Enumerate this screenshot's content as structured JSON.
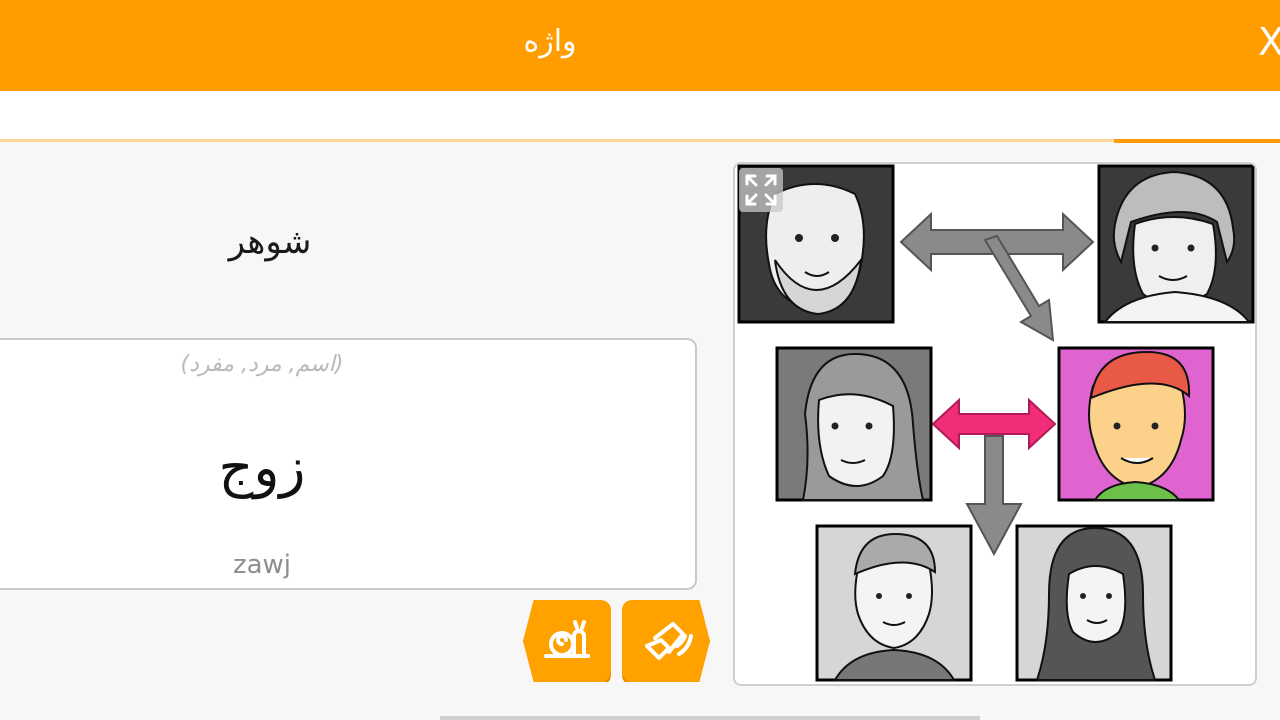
{
  "header": {
    "title": "واژه",
    "close_label": "X",
    "bg_color": "#ff9c00"
  },
  "progress": {
    "fraction": 0.13
  },
  "word": {
    "native": "شوهر",
    "grammar": "(اسم, مرد, مفرد)",
    "target": "زوج",
    "transliteration": "zawj"
  },
  "controls": {
    "slow_audio_icon": "snail-icon",
    "play_audio_icon": "speaker-icon"
  },
  "illustration": {
    "expand_icon": "expand-icon",
    "highlight_color": "#e064d0",
    "arrow_accent_color": "#ef2d78"
  }
}
